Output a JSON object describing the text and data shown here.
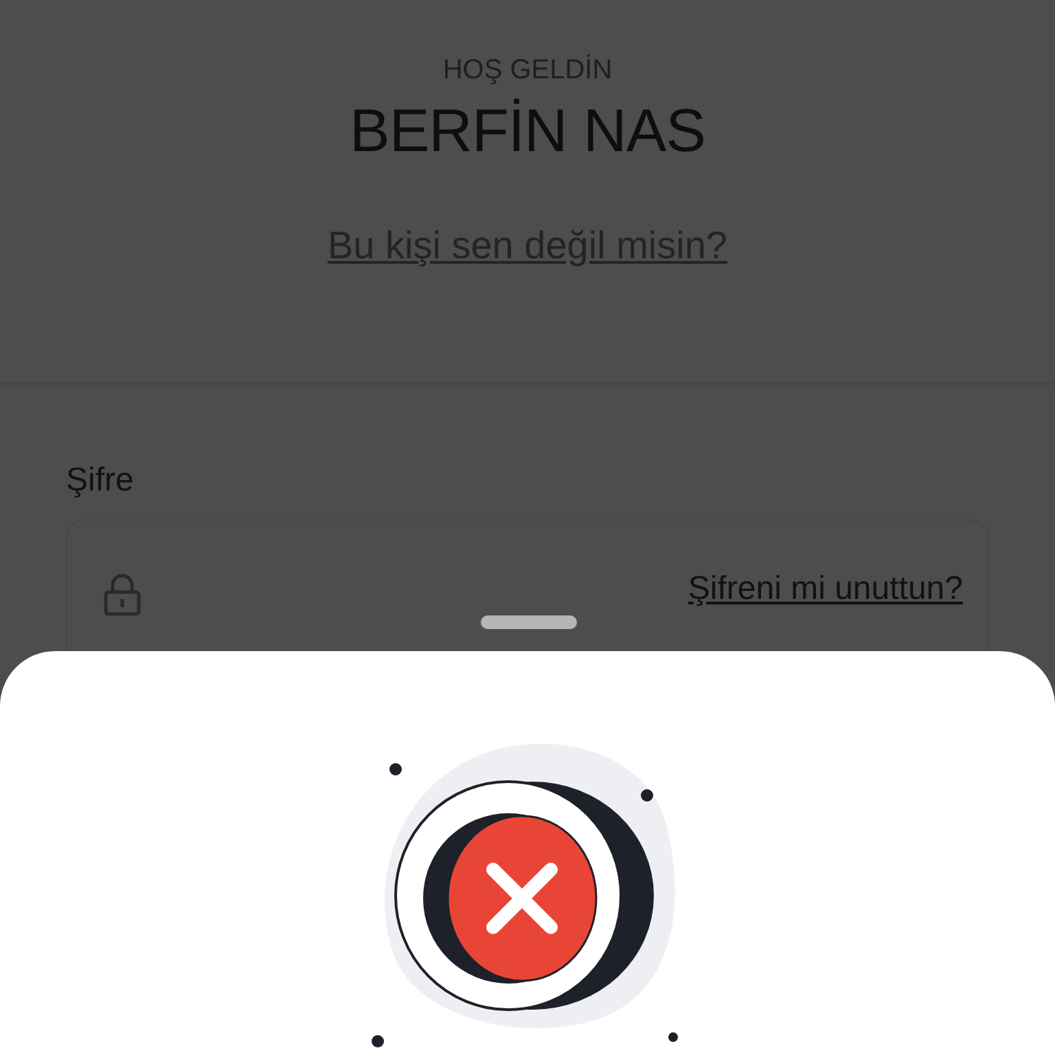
{
  "header": {
    "greeting": "HOŞ GELDİN",
    "name": "BERFİN NAS",
    "not_you_link": "Bu kişi sen değil misin?"
  },
  "password": {
    "label": "Şifre",
    "forgot_link": "Şifreni mi unuttun?"
  }
}
